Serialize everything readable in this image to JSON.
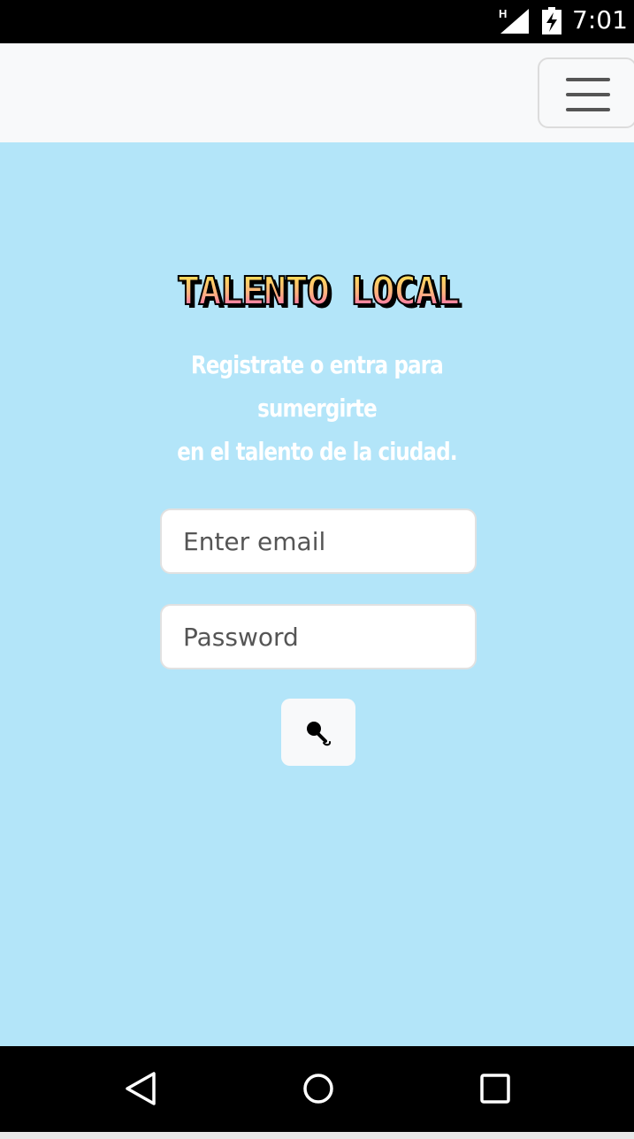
{
  "status_bar": {
    "network": "H",
    "time": "7:01"
  },
  "navbar": {
    "menu_icon": "hamburger-icon"
  },
  "hero": {
    "logo_text": "TALENTO LOCAL",
    "tagline_line1": "Registrate o entra para sumergirte",
    "tagline_line2": "en el talento de la ciudad."
  },
  "form": {
    "email_placeholder": "Enter email",
    "password_placeholder": "Password",
    "submit_icon": "microphone-icon"
  },
  "system_nav": {
    "back_icon": "back-triangle-icon",
    "home_icon": "home-circle-icon",
    "recent_icon": "recent-square-icon"
  },
  "colors": {
    "background": "#b3e5f9",
    "navbar": "#f8f9fa",
    "logo_gradient_top": "#ffe94a",
    "logo_gradient_bottom": "#ff5ec8"
  }
}
